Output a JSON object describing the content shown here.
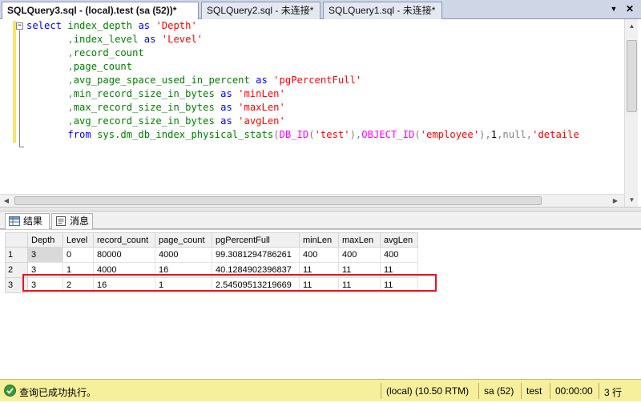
{
  "tabs": [
    {
      "label": "SQLQuery3.sql - (local).test (sa (52))*",
      "active": true
    },
    {
      "label": "SQLQuery2.sql - 未连接*",
      "active": false
    },
    {
      "label": "SQLQuery1.sql - 未连接*",
      "active": false
    }
  ],
  "tabstrip_controls": {
    "dropdown": "▼",
    "close": "✕"
  },
  "editor": {
    "lines": [
      [
        {
          "t": "select ",
          "c": "kw"
        },
        {
          "t": "index_depth ",
          "c": "sys"
        },
        {
          "t": "as ",
          "c": "kw"
        },
        {
          "t": "'Depth'",
          "c": "str"
        }
      ],
      [
        {
          "t": "       ,",
          "c": "gray"
        },
        {
          "t": "index_level ",
          "c": "sys"
        },
        {
          "t": "as ",
          "c": "kw"
        },
        {
          "t": "'Level'",
          "c": "str"
        }
      ],
      [
        {
          "t": "       ,",
          "c": "gray"
        },
        {
          "t": "record_count",
          "c": "sys"
        }
      ],
      [
        {
          "t": "       ,",
          "c": "gray"
        },
        {
          "t": "page_count",
          "c": "sys"
        }
      ],
      [
        {
          "t": "       ,",
          "c": "gray"
        },
        {
          "t": "avg_page_space_used_in_percent ",
          "c": "sys"
        },
        {
          "t": "as ",
          "c": "kw"
        },
        {
          "t": "'pgPercentFull'",
          "c": "str"
        }
      ],
      [
        {
          "t": "       ,",
          "c": "gray"
        },
        {
          "t": "min_record_size_in_bytes ",
          "c": "sys"
        },
        {
          "t": "as ",
          "c": "kw"
        },
        {
          "t": "'minLen'",
          "c": "str"
        }
      ],
      [
        {
          "t": "       ,",
          "c": "gray"
        },
        {
          "t": "max_record_size_in_bytes ",
          "c": "sys"
        },
        {
          "t": "as ",
          "c": "kw"
        },
        {
          "t": "'maxLen'",
          "c": "str"
        }
      ],
      [
        {
          "t": "       ,",
          "c": "gray"
        },
        {
          "t": "avg_record_size_in_bytes ",
          "c": "sys"
        },
        {
          "t": "as ",
          "c": "kw"
        },
        {
          "t": "'avgLen'",
          "c": "str"
        }
      ],
      [
        {
          "t": "       from ",
          "c": "kw"
        },
        {
          "t": "sys.dm_db_index_physical_stats",
          "c": "sys"
        },
        {
          "t": "(",
          "c": "gray"
        },
        {
          "t": "DB_ID",
          "c": "fn"
        },
        {
          "t": "(",
          "c": "gray"
        },
        {
          "t": "'test'",
          "c": "str"
        },
        {
          "t": "),",
          "c": "gray"
        },
        {
          "t": "OBJECT_ID",
          "c": "fn"
        },
        {
          "t": "(",
          "c": "gray"
        },
        {
          "t": "'employee'",
          "c": "str"
        },
        {
          "t": "),",
          "c": "gray"
        },
        {
          "t": "1",
          "c": "plain"
        },
        {
          "t": ",",
          "c": "gray"
        },
        {
          "t": "null",
          "c": "gray"
        },
        {
          "t": ",",
          "c": "gray"
        },
        {
          "t": "'detaile",
          "c": "str"
        }
      ]
    ]
  },
  "result_tabs": [
    {
      "label": "结果",
      "icon": "grid-icon",
      "active": true
    },
    {
      "label": "消息",
      "icon": "message-icon",
      "active": false
    }
  ],
  "grid": {
    "columns": [
      "Depth",
      "Level",
      "record_count",
      "page_count",
      "pgPercentFull",
      "minLen",
      "maxLen",
      "avgLen"
    ],
    "rows": [
      [
        "1",
        "3",
        "0",
        "80000",
        "4000",
        "99.3081294786261",
        "400",
        "400",
        "400"
      ],
      [
        "2",
        "3",
        "1",
        "4000",
        "16",
        "40.1284902396837",
        "11",
        "11",
        "11"
      ],
      [
        "3",
        "3",
        "2",
        "16",
        "1",
        "2.54509513219669",
        "11",
        "11",
        "11"
      ]
    ]
  },
  "status": {
    "message": "查询已成功执行。",
    "server": "(local) (10.50 RTM)",
    "user": "sa (52)",
    "database": "test",
    "elapsed": "00:00:00",
    "rows": "3 行"
  },
  "colors": {
    "status_bar": "#f6ef9c",
    "highlight_box": "#e8141b",
    "keyword": "#0000ff",
    "string": "#ff0000",
    "function": "#ff00ff",
    "system_object": "#008000"
  }
}
